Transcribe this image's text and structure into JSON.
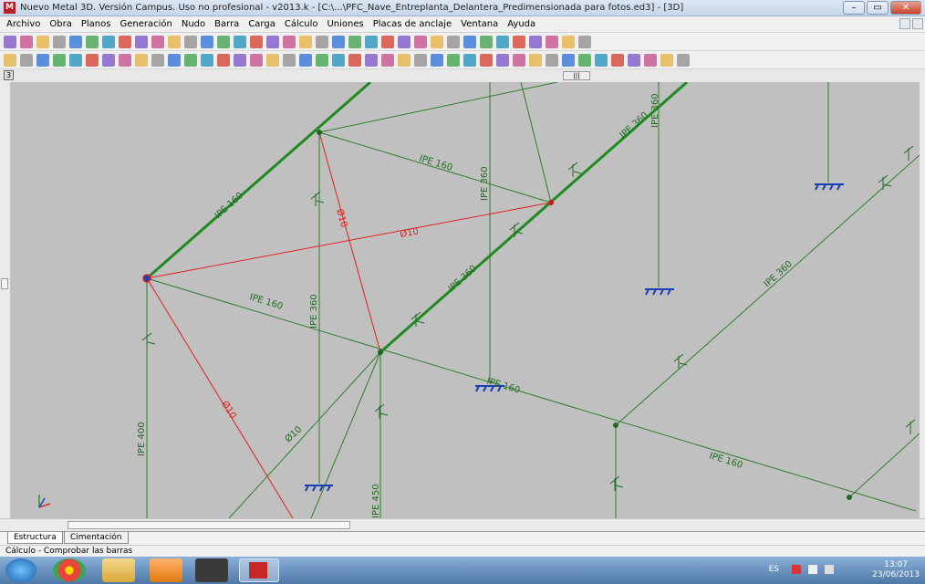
{
  "window": {
    "title": "Nuevo Metal 3D. Versión Campus. Uso no profesional - v2013.k - [C:\\...\\PFC_Nave_Entreplanta_Delantera_Predimensionada para fotos.ed3] - [3D]",
    "app_icon": "app-icon",
    "controls": [
      "minimize",
      "maximize",
      "close"
    ]
  },
  "menubar": {
    "items": [
      "Archivo",
      "Obra",
      "Planos",
      "Generación",
      "Nudo",
      "Barra",
      "Carga",
      "Cálculo",
      "Uniones",
      "Placas de anclaje",
      "Ventana",
      "Ayuda"
    ]
  },
  "canvas": {
    "background": "#c0c0c0",
    "colors": {
      "selected": "#1f8a1f",
      "member": "#2e7d2e",
      "tie": "#e02020",
      "support": "#1a3fb5"
    },
    "labels": {
      "ipe160_a": "IPE 160",
      "ipe160_b": "IPE 160",
      "ipe160_c": "IPE 160",
      "ipe160_d": "IPE 160",
      "ipe160_e": "IPE 160",
      "ipe360_a": "IPE 360",
      "ipe360_b": "IPE 360",
      "ipe360_c": "IPE 360",
      "ipe360_d": "IPE 360",
      "ipe360_e": "IPE 360",
      "ipe360_f": "IPE 360",
      "ipe400": "IPE 400",
      "ipe450": "IPE 450",
      "d10_a": "Ø10",
      "d10_b": "Ø10",
      "d10_c": "Ø10",
      "d10_d": "Ø10"
    }
  },
  "tabs": [
    "Estructura",
    "Cimentación"
  ],
  "status": "Cálculo - Comprobar las barras",
  "taskbar": {
    "apps": [
      "start",
      "chrome",
      "explorer",
      "media-player",
      "adobe",
      "cype-metal-3d"
    ],
    "clock_time": "13:07",
    "clock_date": "23/06/2013",
    "lang": "ES"
  }
}
